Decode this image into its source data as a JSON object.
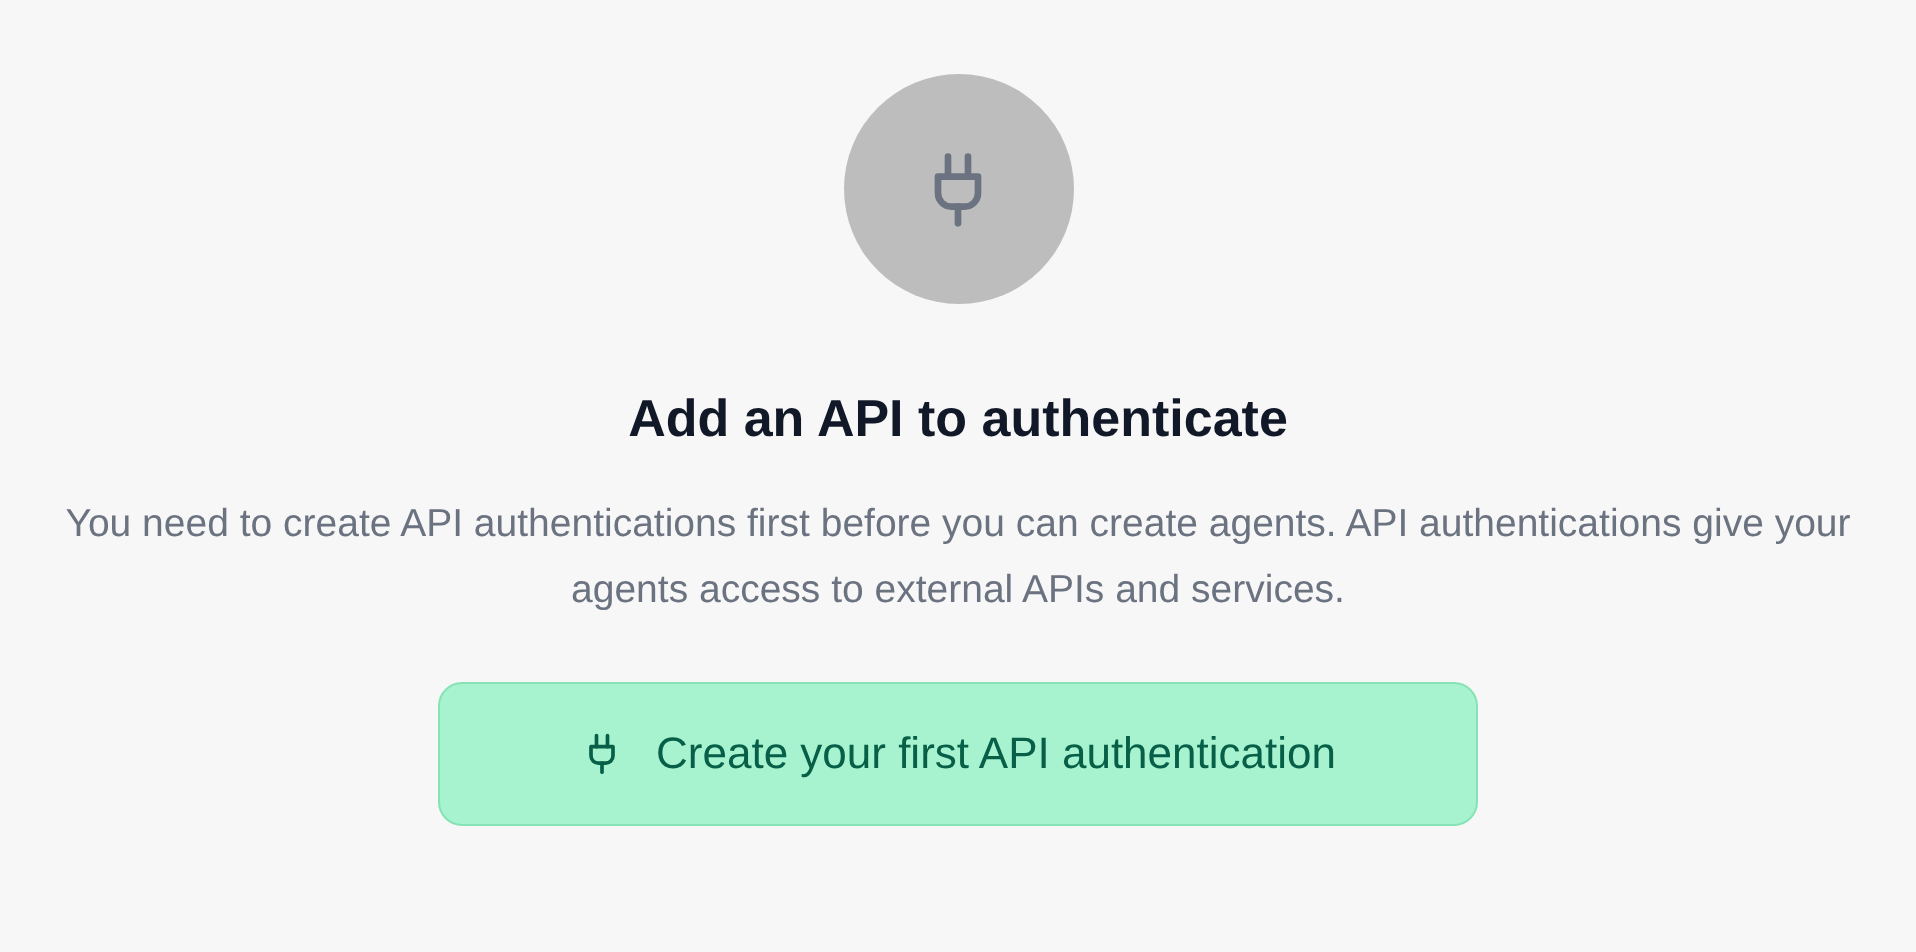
{
  "empty_state": {
    "title": "Add an API to authenticate",
    "description": "You need to create API authentications first before you can create agents. API authentications give your agents access to external APIs and services.",
    "button": {
      "label": "Create your first API authentication"
    }
  }
}
